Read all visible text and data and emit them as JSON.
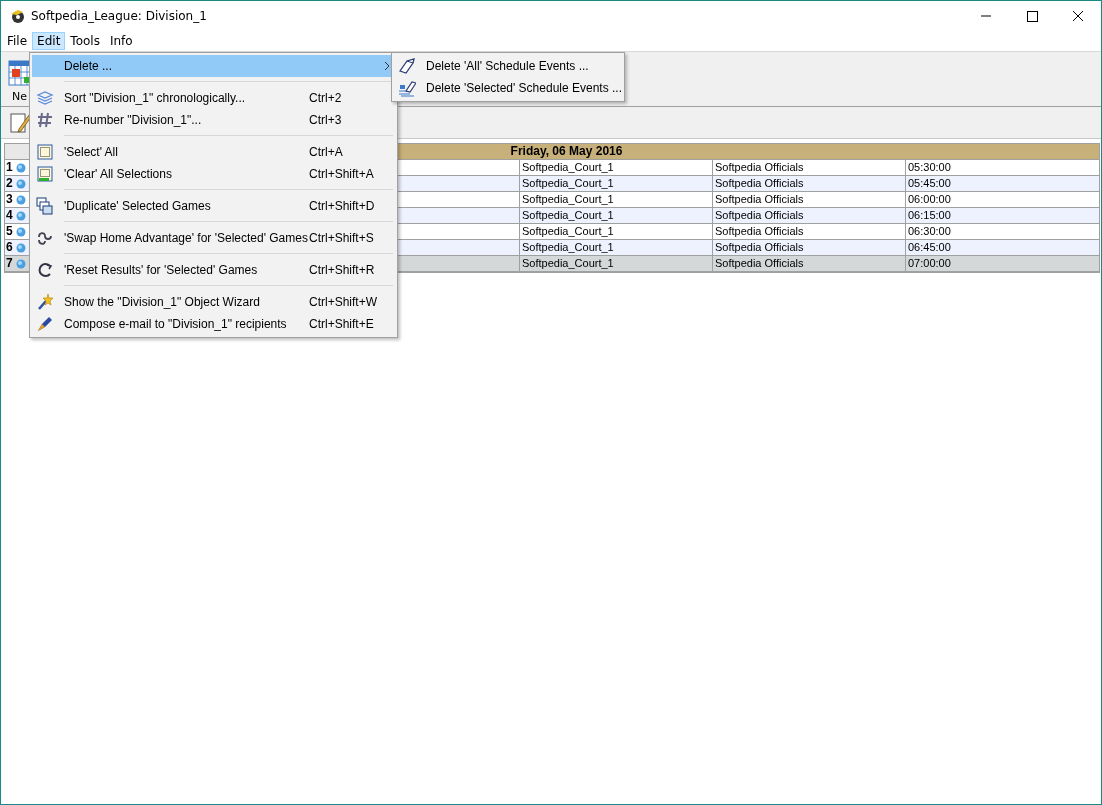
{
  "window": {
    "title": "Softpedia_League: Division_1"
  },
  "menu_bar": [
    {
      "label": "File",
      "selected": false
    },
    {
      "label": "Edit",
      "selected": true
    },
    {
      "label": "Tools",
      "selected": false
    },
    {
      "label": "Info",
      "selected": false
    }
  ],
  "toolbar": {
    "new_label": "Ne"
  },
  "schedule": {
    "date_header": "Friday, 06 May 2016",
    "rows": [
      {
        "number": "1",
        "court": "Softpedia_Court_1",
        "officials": "Softpedia Officials",
        "time": "05:30:00",
        "selected": false
      },
      {
        "number": "2",
        "court": "Softpedia_Court_1",
        "officials": "Softpedia Officials",
        "time": "05:45:00",
        "selected": false
      },
      {
        "number": "3",
        "court": "Softpedia_Court_1",
        "officials": "Softpedia Officials",
        "time": "06:00:00",
        "selected": false
      },
      {
        "number": "4",
        "court": "Softpedia_Court_1",
        "officials": "Softpedia Officials",
        "time": "06:15:00",
        "selected": false
      },
      {
        "number": "5",
        "court": "Softpedia_Court_1",
        "officials": "Softpedia Officials",
        "time": "06:30:00",
        "selected": false
      },
      {
        "number": "6",
        "court": "Softpedia_Court_1",
        "officials": "Softpedia Officials",
        "time": "06:45:00",
        "selected": false
      },
      {
        "number": "7",
        "court": "Softpedia_Court_1",
        "officials": "Softpedia Officials",
        "time": "07:00:00",
        "selected": true
      }
    ]
  },
  "edit_menu": {
    "items": [
      {
        "kind": "submenu",
        "label": "Delete ...",
        "selected": true
      },
      {
        "kind": "separator"
      },
      {
        "kind": "item",
        "label": "Sort \"Division_1\" chronologically...",
        "shortcut": "Ctrl+2",
        "selected": false
      },
      {
        "kind": "item",
        "label": "Re-number \"Division_1\"...",
        "shortcut": "Ctrl+3",
        "selected": false
      },
      {
        "kind": "separator"
      },
      {
        "kind": "item",
        "label": "'Select' All",
        "shortcut": "Ctrl+A",
        "selected": false
      },
      {
        "kind": "item",
        "label": "'Clear' All Selections",
        "shortcut": "Ctrl+Shift+A",
        "selected": false
      },
      {
        "kind": "separator"
      },
      {
        "kind": "item",
        "label": "'Duplicate' Selected Games",
        "shortcut": "Ctrl+Shift+D",
        "selected": false
      },
      {
        "kind": "separator"
      },
      {
        "kind": "item",
        "label": "'Swap Home Advantage' for 'Selected' Games",
        "shortcut": "Ctrl+Shift+S",
        "selected": false
      },
      {
        "kind": "separator"
      },
      {
        "kind": "item",
        "label": "'Reset Results' for 'Selected' Games",
        "shortcut": "Ctrl+Shift+R",
        "selected": false
      },
      {
        "kind": "separator"
      },
      {
        "kind": "item",
        "label": "Show the \"Division_1\" Object Wizard",
        "shortcut": "Ctrl+Shift+W",
        "selected": false
      },
      {
        "kind": "item",
        "label": "Compose e-mail to \"Division_1\" recipients",
        "shortcut": "Ctrl+Shift+E",
        "selected": false
      }
    ]
  },
  "delete_submenu": {
    "items": [
      {
        "label": "Delete 'All' Schedule Events ...",
        "selected": false
      },
      {
        "label": "Delete 'Selected' Schedule Events ...",
        "selected": false
      }
    ]
  }
}
